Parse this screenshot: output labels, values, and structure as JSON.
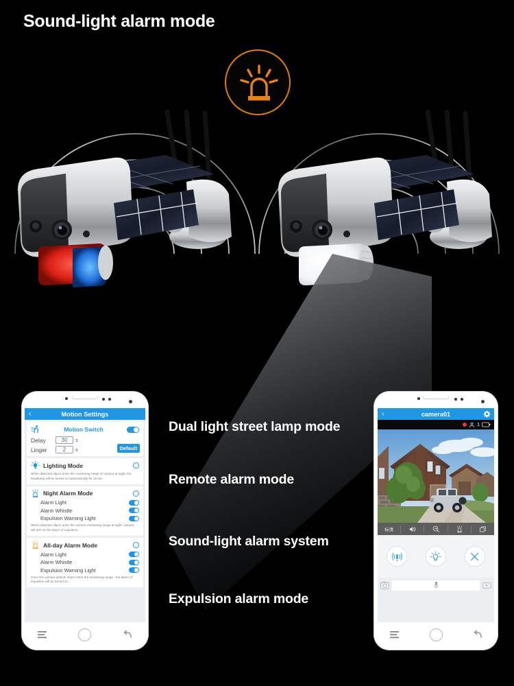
{
  "headline": "Sound-light alarm mode",
  "badge": {
    "icon": "siren-beacon-icon",
    "color": "#e8821a"
  },
  "devices": [
    {
      "name": "solar-security-camera-left",
      "indicator": "red-blue-alarm-light"
    },
    {
      "name": "solar-security-camera-right",
      "indicator": "white-floodlight"
    }
  ],
  "features": [
    "Dual light street lamp mode",
    "Remote alarm mode",
    "Sound-light alarm system",
    "Expulsion alarm mode"
  ],
  "phone_left": {
    "appbar": {
      "back": "‹",
      "title": "Motion Settings",
      "gear": "gear-icon"
    },
    "motion": {
      "title": "Motion Switch",
      "switch_on": true,
      "delay_label": "Delay",
      "delay_value": "30",
      "delay_unit": "s",
      "linger_label": "Linger",
      "linger_value": "2",
      "linger_unit": "s",
      "default_label": "Default"
    },
    "modes": [
      {
        "title": "Lighting Mode",
        "icon": "bulb-icon",
        "selected": false,
        "desc": "When detected object enter the monitoring range of camera at night, the headlamp will be turned on automatically for 15 sec.",
        "options": []
      },
      {
        "title": "Night  Alarm Mode",
        "icon": "siren-blue-icon",
        "selected": false,
        "desc": "When detected object enter the camera monitoring range at night, camera will turn on the alarm of expulsion.",
        "options": [
          {
            "label": "Alarm Light",
            "on": true
          },
          {
            "label": "Alarm Whistle",
            "on": true
          },
          {
            "label": "Expulsion Warning Light",
            "on": true
          }
        ]
      },
      {
        "title": "All-day Alarm Mode",
        "icon": "siren-orange-icon",
        "selected": false,
        "desc": "Once the camera detects object enter the monitoring range , the alarm of expulsion will be turned on .",
        "options": [
          {
            "label": "Alarm Light",
            "on": true
          },
          {
            "label": "Alarm Whistle",
            "on": true
          },
          {
            "label": "Expulsion Warning Light",
            "on": true
          }
        ]
      }
    ],
    "nav": {
      "menu": "menu-icon",
      "home": "home-icon",
      "back": "back-icon"
    }
  },
  "phone_right": {
    "appbar": {
      "back": "‹",
      "title": "camera01",
      "gear": "gear-icon"
    },
    "status": {
      "recording": true,
      "viewer_count": "1",
      "battery": "battery-icon"
    },
    "video": {
      "scene": "house-driveway-with-suv"
    },
    "toolbar": [
      {
        "label": "标清",
        "name": "quality-button"
      },
      {
        "label": "",
        "name": "speaker-icon"
      },
      {
        "label": "",
        "name": "zoom-icon"
      },
      {
        "label": "",
        "name": "alarm-icon"
      },
      {
        "label": "",
        "name": "snapshot-icon"
      }
    ],
    "controls": [
      {
        "name": "siren-button"
      },
      {
        "name": "light-button"
      },
      {
        "name": "close-button"
      }
    ],
    "talk": {
      "camera": "camera-icon",
      "mic": "microphone-icon",
      "record": "video-record-icon"
    },
    "nav": {
      "menu": "menu-icon",
      "home": "home-icon",
      "back": "back-icon"
    }
  }
}
